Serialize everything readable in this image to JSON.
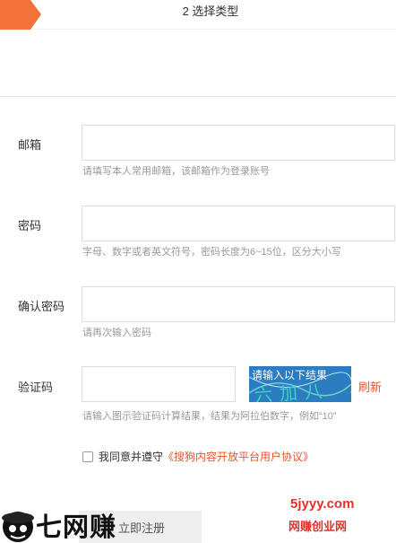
{
  "step": {
    "title": "2 选择类型"
  },
  "form": {
    "email": {
      "label": "邮箱",
      "value": "",
      "hint": "请填写本人常用邮箱，该邮箱作为登录账号"
    },
    "password": {
      "label": "密码",
      "value": "",
      "hint": "字母、数字或者英文符号，密码长度为6~15位，区分大小写"
    },
    "confirm": {
      "label": "确认密码",
      "value": "",
      "hint": "请再次输入密码"
    },
    "captcha": {
      "label": "验证码",
      "value": "",
      "hint": "请输入图示验证码计算结果，结果为阿拉伯数字，例如“10”",
      "image_text": "请输入以下结果",
      "image_glyphs": "六加八",
      "refresh_label": "刷新"
    },
    "agree": {
      "prefix": "我同意并遵守",
      "link": "《搜狗内容开放平台用户协议》",
      "checked": false
    },
    "submit_label": "立即注册"
  },
  "watermark": {
    "left_text": "七网赚",
    "right_line1": "5jyyy.com",
    "right_line2": "网赚创业网"
  },
  "colors": {
    "accent": "#f2723a",
    "link": "#e8542e",
    "captcha_bg": "#2b7cc1"
  }
}
